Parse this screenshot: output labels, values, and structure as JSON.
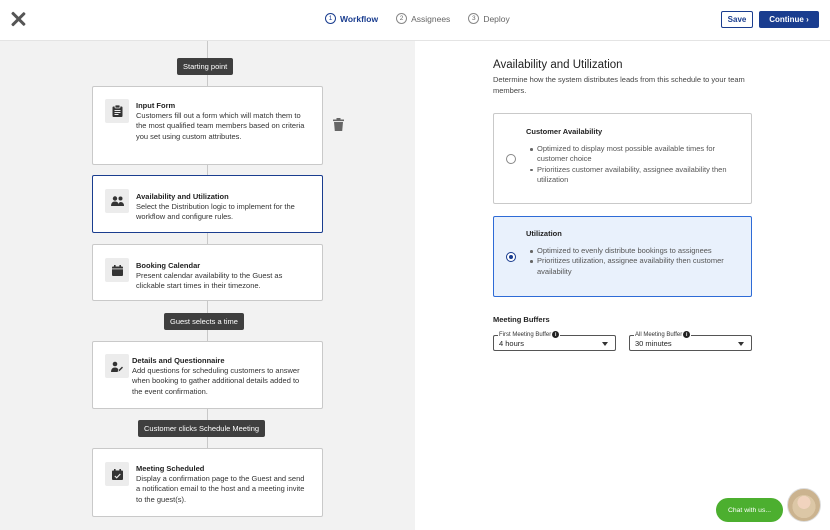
{
  "header": {
    "steps": [
      {
        "num": "1",
        "label": "Workflow"
      },
      {
        "num": "2",
        "label": "Assignees"
      },
      {
        "num": "3",
        "label": "Deploy"
      }
    ],
    "save_label": "Save",
    "continue_label": "Continue ›"
  },
  "workflow": {
    "pills": [
      "Starting point",
      "Guest selects a time",
      "Customer clicks Schedule Meeting"
    ],
    "nodes": [
      {
        "title": "Input Form",
        "description": "Customers fill out a form which will match them to the most qualified team members based on criteria you set using custom attributes.",
        "icon": "clipboard-icon"
      },
      {
        "title": "Availability and Utilization",
        "description": "Select the Distribution logic to implement for the workflow and configure rules.",
        "icon": "people-icon"
      },
      {
        "title": "Booking Calendar",
        "description": "Present calendar availability to the Guest as clickable start times in their timezone.",
        "icon": "calendar-icon"
      },
      {
        "title": "Details and Questionnaire",
        "description": "Add questions for scheduling customers to answer when booking to gather additional details added to the event confirmation.",
        "icon": "person-edit-icon"
      },
      {
        "title": "Meeting Scheduled",
        "description": "Display a confirmation page to the Guest and send a notification email to the host and a meeting invite to the guest(s).",
        "icon": "calendar-check-icon"
      }
    ]
  },
  "panel": {
    "title": "Availability and Utilization",
    "description": "Determine how the system distributes leads from this schedule to your team members.",
    "options": [
      {
        "title": "Customer Availability",
        "bullets": [
          "Optimized to display most possible available times for customer choice",
          "Prioritizes customer availability, assignee availability then utilization"
        ],
        "selected": false
      },
      {
        "title": "Utilization",
        "bullets": [
          "Optimized to evenly distribute bookings to assignees",
          "Prioritizes utilization, assignee availability then customer availability"
        ],
        "selected": true
      }
    ],
    "buffers_title": "Meeting Buffers",
    "first_buffer": {
      "label": "First Meeting Buffer",
      "value": "4 hours"
    },
    "all_buffer": {
      "label": "All Meeting Buffer",
      "value": "30 minutes"
    }
  },
  "chat": {
    "label": "Chat with us..."
  },
  "colors": {
    "accent": "#1a3d8f",
    "selected_bg": "#e9f1fc",
    "chat": "#4caf2f",
    "left_bg": "#f2f2f2"
  }
}
